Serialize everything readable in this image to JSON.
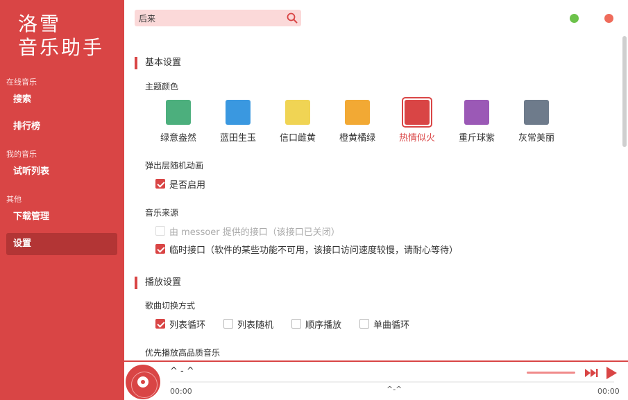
{
  "app": {
    "logo_line1": "洛雪",
    "logo_line2": "音乐助手"
  },
  "sidebar": {
    "groups": [
      {
        "title": "在线音乐",
        "items": [
          "搜索",
          "排行榜"
        ]
      },
      {
        "title": "我的音乐",
        "items": [
          "试听列表"
        ]
      },
      {
        "title": "其他",
        "items": [
          "下载管理",
          "设置"
        ]
      }
    ],
    "active_item": "设置"
  },
  "search": {
    "value": "后来",
    "placeholder": ""
  },
  "settings": {
    "basic_title": "基本设置",
    "theme_label": "主题颜色",
    "themes": [
      {
        "name": "绿意盎然",
        "color": "#4caf7d"
      },
      {
        "name": "蓝田生玉",
        "color": "#3a98e0"
      },
      {
        "name": "信口雌黄",
        "color": "#f0d454"
      },
      {
        "name": "橙黄橘绿",
        "color": "#f2a934"
      },
      {
        "name": "热情似火",
        "color": "#d94545"
      },
      {
        "name": "重斤球紫",
        "color": "#9b59b6"
      },
      {
        "name": "灰常美丽",
        "color": "#6e7b8b"
      }
    ],
    "selected_theme": "热情似火",
    "popup_anim_label": "弹出层随机动画",
    "popup_anim_option": "是否启用",
    "popup_anim_checked": true,
    "music_source_label": "音乐来源",
    "source_options": [
      {
        "label": "由 messoer 提供的接口（该接口已关闭）",
        "checked": false,
        "disabled": true
      },
      {
        "label": "临时接口（软件的某些功能不可用，该接口访问速度较慢，请耐心等待）",
        "checked": true,
        "disabled": false
      }
    ],
    "play_title": "播放设置",
    "switch_mode_label": "歌曲切换方式",
    "switch_modes": [
      {
        "label": "列表循环",
        "checked": true
      },
      {
        "label": "列表随机",
        "checked": false
      },
      {
        "label": "顺序播放",
        "checked": false
      },
      {
        "label": "单曲循环",
        "checked": false
      }
    ],
    "hq_label": "优先播放高品质音乐"
  },
  "player": {
    "title": "^ - ^",
    "time_current": "00:00",
    "time_mid": "^-^",
    "time_total": "00:00",
    "progress": 0
  },
  "colors": {
    "accent": "#d94545",
    "win_min": "#6cc24a",
    "win_close": "#ef6b5b"
  }
}
